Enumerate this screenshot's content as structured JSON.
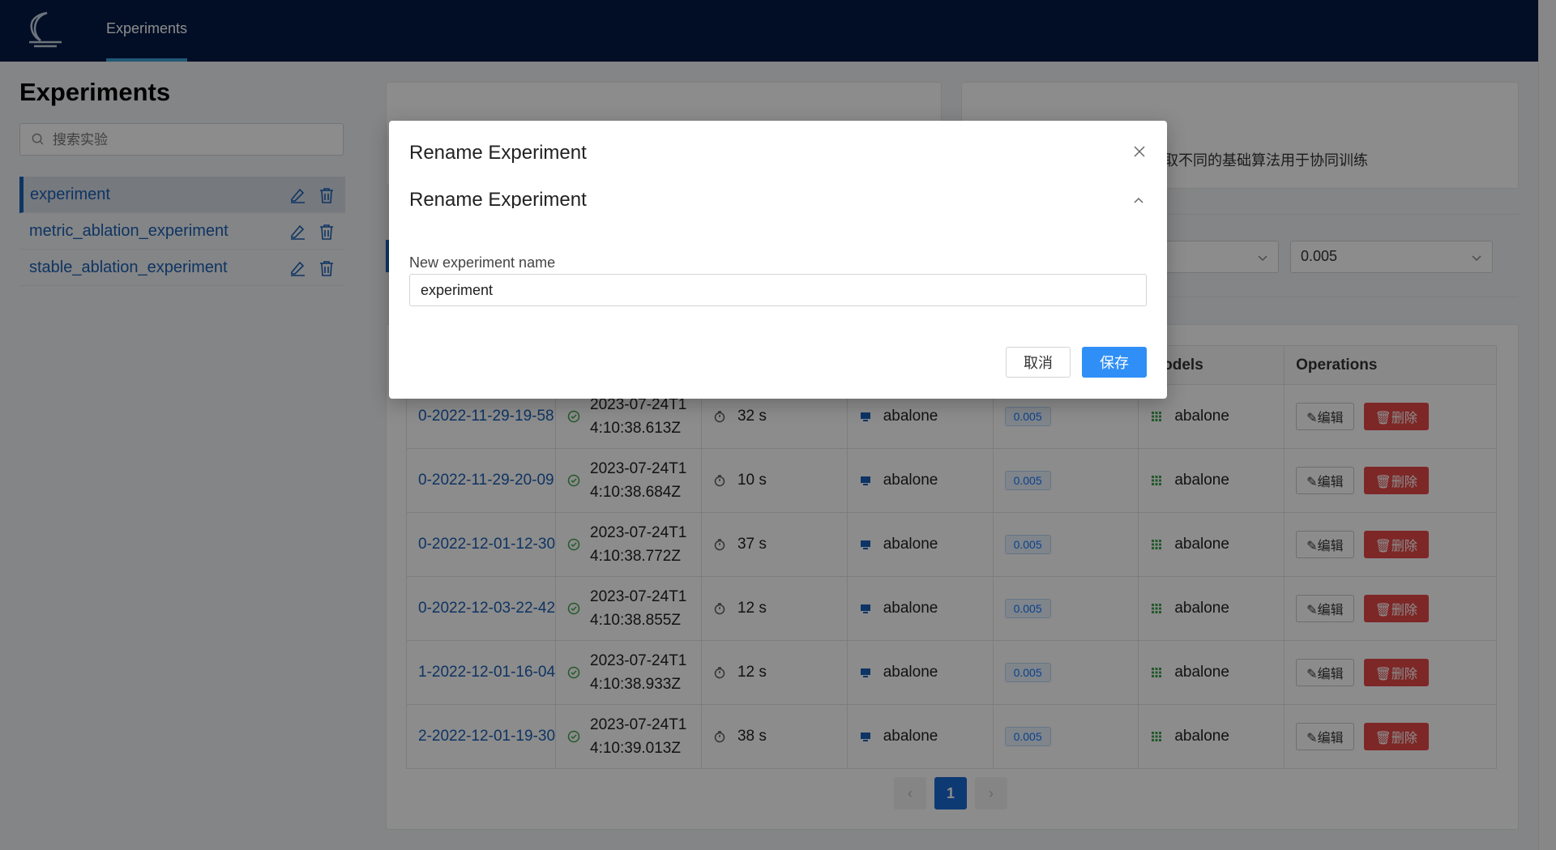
{
  "header": {
    "nav_experiments": "Experiments"
  },
  "sidebar": {
    "title": "Experiments",
    "search_placeholder": "搜索实验",
    "items": [
      {
        "label": "experiment",
        "active": true
      },
      {
        "label": "metric_ablation_experiment",
        "active": false
      },
      {
        "label": "stable_ablation_experiment",
        "active": false
      }
    ]
  },
  "background": {
    "card2_text": "选取不同的基础算法用于协同训练",
    "filter_lr": "0.005"
  },
  "table": {
    "headers": {
      "models": "Models",
      "operations": "Operations"
    },
    "rows": [
      {
        "name": "0-2022-11-29-19-58",
        "created": "2023-07-24T1\n4:10:38.613Z",
        "duration": "32 s",
        "dataset": "abalone",
        "lr": "0.005",
        "model": "abalone"
      },
      {
        "name": "0-2022-11-29-20-09",
        "created": "2023-07-24T1\n4:10:38.684Z",
        "duration": "10 s",
        "dataset": "abalone",
        "lr": "0.005",
        "model": "abalone"
      },
      {
        "name": "0-2022-12-01-12-30",
        "created": "2023-07-24T1\n4:10:38.772Z",
        "duration": "37 s",
        "dataset": "abalone",
        "lr": "0.005",
        "model": "abalone"
      },
      {
        "name": "0-2022-12-03-22-42",
        "created": "2023-07-24T1\n4:10:38.855Z",
        "duration": "12 s",
        "dataset": "abalone",
        "lr": "0.005",
        "model": "abalone"
      },
      {
        "name": "1-2022-12-01-16-04",
        "created": "2023-07-24T1\n4:10:38.933Z",
        "duration": "12 s",
        "dataset": "abalone",
        "lr": "0.005",
        "model": "abalone"
      },
      {
        "name": "2-2022-12-01-19-30",
        "created": "2023-07-24T1\n4:10:39.013Z",
        "duration": "38 s",
        "dataset": "abalone",
        "lr": "0.005",
        "model": "abalone"
      }
    ],
    "edit_label": "编辑",
    "delete_label": "删除"
  },
  "pagination": {
    "prev": "‹",
    "current": "1",
    "next": "›"
  },
  "modal": {
    "title": "Rename Experiment",
    "section_title": "Rename Experiment",
    "field_label": "New experiment name",
    "field_value": "experiment",
    "cancel_label": "取消",
    "save_label": "保存"
  }
}
